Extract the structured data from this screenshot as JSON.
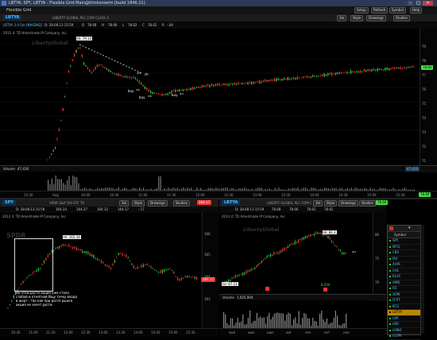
{
  "window": {
    "title": "LBTYA, SPY, LBTYA - Flexible Grid Main@thinkorswim [build 1846.21]",
    "menu": [
      "Flexible Grid"
    ],
    "right_buttons": [
      "Setup",
      "Refresh",
      "Symbol",
      "Help"
    ]
  },
  "top_chart": {
    "symbol": "LBTYA",
    "company": "LIBERTY GLOBAL PLC COM CLASS A",
    "info": "LBTYA 3 d 5m [NASDAQ]",
    "date": "D: 28.08.13 15:59",
    "o_label": "O",
    "o_val": "78.68",
    "h_label": "H",
    "h_val": "78.66",
    "l_label": "L",
    "l_val": "78.62",
    "c_label": "C",
    "c_val": "78.62",
    "r_label": "R",
    "r_val": "-.04",
    "copyright": "2013 © TD Ameritrade IP Company, Inc.",
    "watermark": "LibertyGlobal",
    "hi_label": "Hi: 79.14",
    "timeframe": "3m",
    "style": "Style",
    "drawings": "Drawings",
    "studies": "Studies",
    "annotations": {
      "sh": "sh",
      "buy1": "buy",
      "buy2": "buy",
      "buy3": "buy"
    },
    "price_badge": "78.62",
    "price_axis": [
      "79",
      "78",
      "77",
      "76",
      "75",
      "74",
      "73",
      "72",
      "71"
    ],
    "volume_label": "Volume",
    "volume_val": "47,416",
    "volume_badge": "47,416",
    "time_axis": [
      "15:30",
      "Aug",
      "10:00",
      "10:30",
      "11:00",
      "11:30",
      "12:00",
      "12:30",
      "13:00",
      "13:30",
      "14:00",
      "14:30",
      "15:00",
      "15:30"
    ],
    "footer_badge": "78.69"
  },
  "bottom_left": {
    "symbol": "SPY",
    "info": "SPDR S&P 500 ETF TR",
    "date": "D: 28.08.13 15:59",
    "o_val": "164.34",
    "h_val": "164.27",
    "l_val": "164.12",
    "c_val": "164.17",
    "r_val": "-.17",
    "copyright": "2013 © TD Ameritrade IP Company, Inc.",
    "watermark": "SPDR",
    "hi_label": "Hi: 165.34",
    "price_badge": "164.17",
    "header_badge": "164.17",
    "timeframe": "3m",
    "style": "Style",
    "drawings": "Drawings",
    "studies": "Studies",
    "note": "На этом росте акция уже стала слабой и отнятной Ищу точку входа в шорт - так как при росте рынка акция не хочет расти",
    "price_axis": [
      "166",
      "165",
      "164",
      "163"
    ],
    "time_axis": [
      "10:30",
      "11:00",
      "11:30",
      "12:00",
      "12:30",
      "13:00",
      "13:30",
      "14:00",
      "14:30",
      "15:00",
      "15:30"
    ]
  },
  "bottom_mid": {
    "symbol": "LBTYA",
    "info": "LIBERTY GLOBAL PLC COM CLASS A",
    "date": "D: 28.08.13 15:59",
    "o_val": "78.68",
    "h_val": "78.66",
    "l_val": "78.62",
    "c_val": "78.62",
    "copyright": "2013 © TD Ameritrade IP Company, Inc.",
    "watermark": "LibertyGlobal",
    "hi_label": "Hi: 82.2",
    "lo_label": "Lo: 67.11",
    "mid_label": "8.034",
    "header_badge": "78.69",
    "timeframe": "3m",
    "style": "Style",
    "drawings": "Drawings",
    "studies": "Studies",
    "volume_label": "Volume",
    "volume_val": "1,025,004",
    "price_axis": [
      "80",
      "75",
      "70"
    ],
    "time_axis": [
      "май",
      "июн",
      "июл",
      "авг",
      "сен",
      "окт",
      "ноя"
    ]
  },
  "watchlist": {
    "title": "Symbol",
    "symbols": [
      "SPY",
      "INTU",
      "CBS",
      "MU",
      "AAPL",
      "CHL",
      "KLAC",
      "AMD",
      "FB",
      "XOM",
      "FFPT",
      "KCG",
      "LBTYA",
      "LBR",
      "LNR",
      "LMBO",
      "LLOM"
    ],
    "selected": "LBTYA"
  },
  "colors": {
    "up": "#2ecc40",
    "down": "#ff3030",
    "accent": "#1e7bd8",
    "price_badge": "#44dd44",
    "price_badge_red": "#ff3333"
  }
}
